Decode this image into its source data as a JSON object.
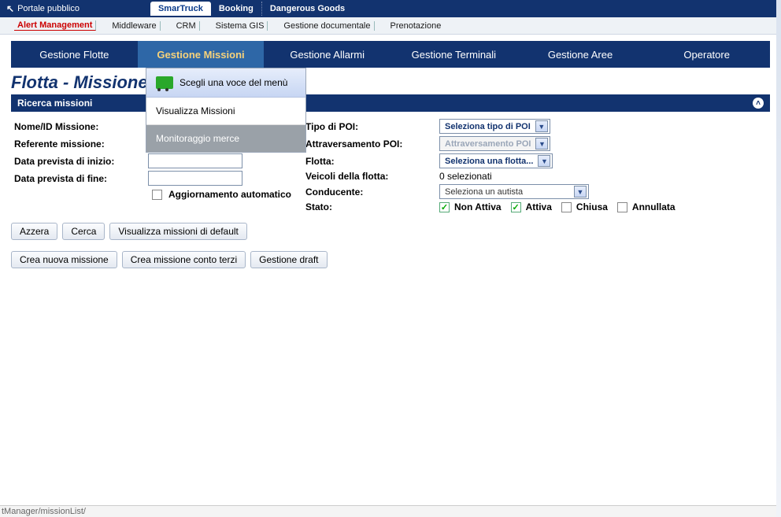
{
  "top": {
    "back_label": "Portale pubblico",
    "tabs": [
      "SmarTruck",
      "Booking",
      "Dangerous Goods"
    ],
    "active_tab": 0
  },
  "second_nav": {
    "items": [
      "Alert Management",
      "Middleware",
      "CRM",
      "Sistema GIS",
      "Gestione documentale",
      "Prenotazione"
    ]
  },
  "main_nav": {
    "items": [
      "Gestione Flotte",
      "Gestione Missioni",
      "Gestione Allarmi",
      "Gestione Terminali",
      "Gestione Aree",
      "Operatore"
    ],
    "hovered": 1
  },
  "dropdown": {
    "header": "Scegli una voce del menù",
    "items": [
      "Visualizza Missioni",
      "Monitoraggio merce"
    ]
  },
  "page_title": "Flotta - Missione",
  "panel": {
    "header": "Ricerca missioni"
  },
  "form": {
    "left_labels": {
      "nome": "Nome/ID Missione:",
      "referente": "Referente missione:",
      "data_inizio": "Data prevista di inizio:",
      "data_fine": "Data prevista di fine:",
      "auto": "Aggiornamento automatico"
    },
    "right": {
      "tipo_poi_label": "Tipo di POI:",
      "tipo_poi_value": "Seleziona tipo di POI",
      "attraversamento_label": "Attraversamento POI:",
      "attraversamento_value": "Attraversamento POI",
      "flotta_label": "Flotta:",
      "flotta_value": "Seleziona una flotta...",
      "veicoli_label": "Veicoli della flotta:",
      "veicoli_value": "0 selezionati",
      "conducente_label": "Conducente:",
      "conducente_value": "Seleziona un autista",
      "stato_label": "Stato:",
      "stato_opts": {
        "non_attiva": "Non Attiva",
        "attiva": "Attiva",
        "chiusa": "Chiusa",
        "annullata": "Annullata"
      }
    }
  },
  "buttons_row1": {
    "azzera": "Azzera",
    "cerca": "Cerca",
    "default": "Visualizza missioni di default"
  },
  "buttons_row2": {
    "nuova": "Crea nuova missione",
    "terzi": "Crea missione conto terzi",
    "draft": "Gestione draft"
  },
  "status_bottom": "tManager/missionList/"
}
